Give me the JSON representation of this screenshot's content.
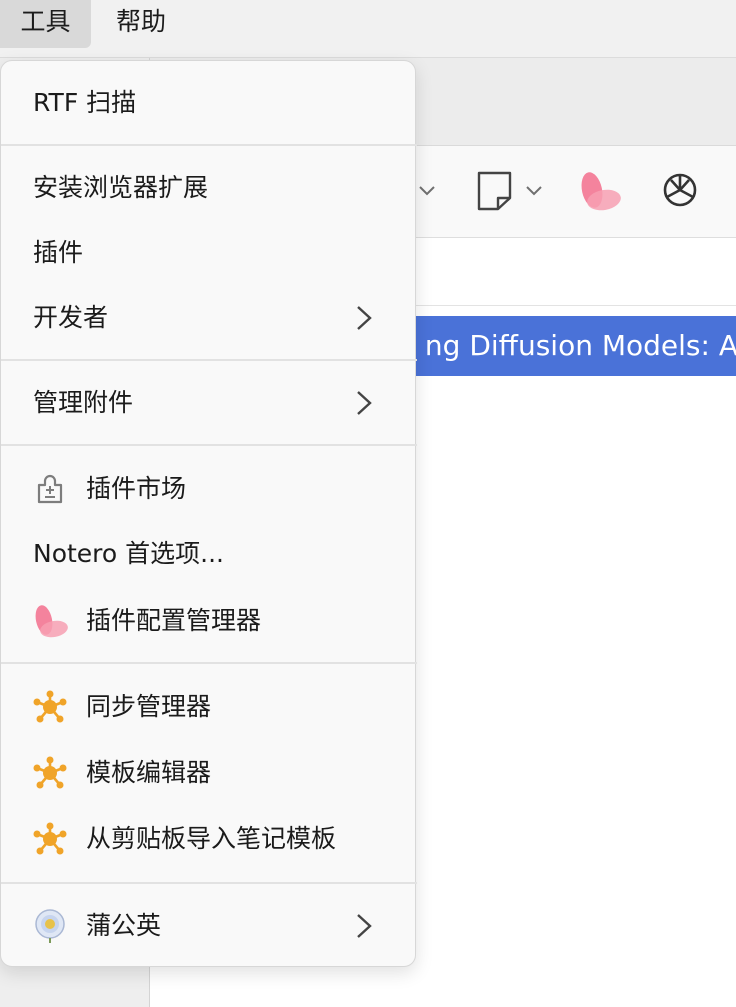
{
  "menubar": {
    "tools": "工具",
    "help": "帮助"
  },
  "main": {
    "selected_row_text": "ng Diffusion Models: A",
    "selection_color": "#4a72d8"
  },
  "toolbar": {
    "icons": [
      "chevron-down-icon",
      "note-icon",
      "petal-icon",
      "openai-icon"
    ]
  },
  "menu": {
    "items": [
      {
        "label": "RTF 扫描",
        "icon": null,
        "submenu": false
      },
      {
        "label": "安装浏览器扩展",
        "icon": null,
        "submenu": false
      },
      {
        "label": "插件",
        "icon": null,
        "submenu": false
      },
      {
        "label": "开发者",
        "icon": null,
        "submenu": true
      },
      {
        "label": "管理附件",
        "icon": null,
        "submenu": true
      },
      {
        "label": "插件市场",
        "icon": "plugin-market-icon",
        "submenu": false
      },
      {
        "label": "Notero 首选项...",
        "icon": null,
        "submenu": false
      },
      {
        "label": "插件配置管理器",
        "icon": "petal-icon",
        "submenu": false
      },
      {
        "label": "同步管理器",
        "icon": "hub-icon",
        "submenu": false
      },
      {
        "label": "模板编辑器",
        "icon": "hub-icon",
        "submenu": false
      },
      {
        "label": "从剪贴板导入笔记模板",
        "icon": "hub-icon",
        "submenu": false
      },
      {
        "label": "蒲公英",
        "icon": "dandelion-icon",
        "submenu": true
      }
    ],
    "accent_orange": "#f0a429",
    "accent_pink": "#f36f8d"
  }
}
